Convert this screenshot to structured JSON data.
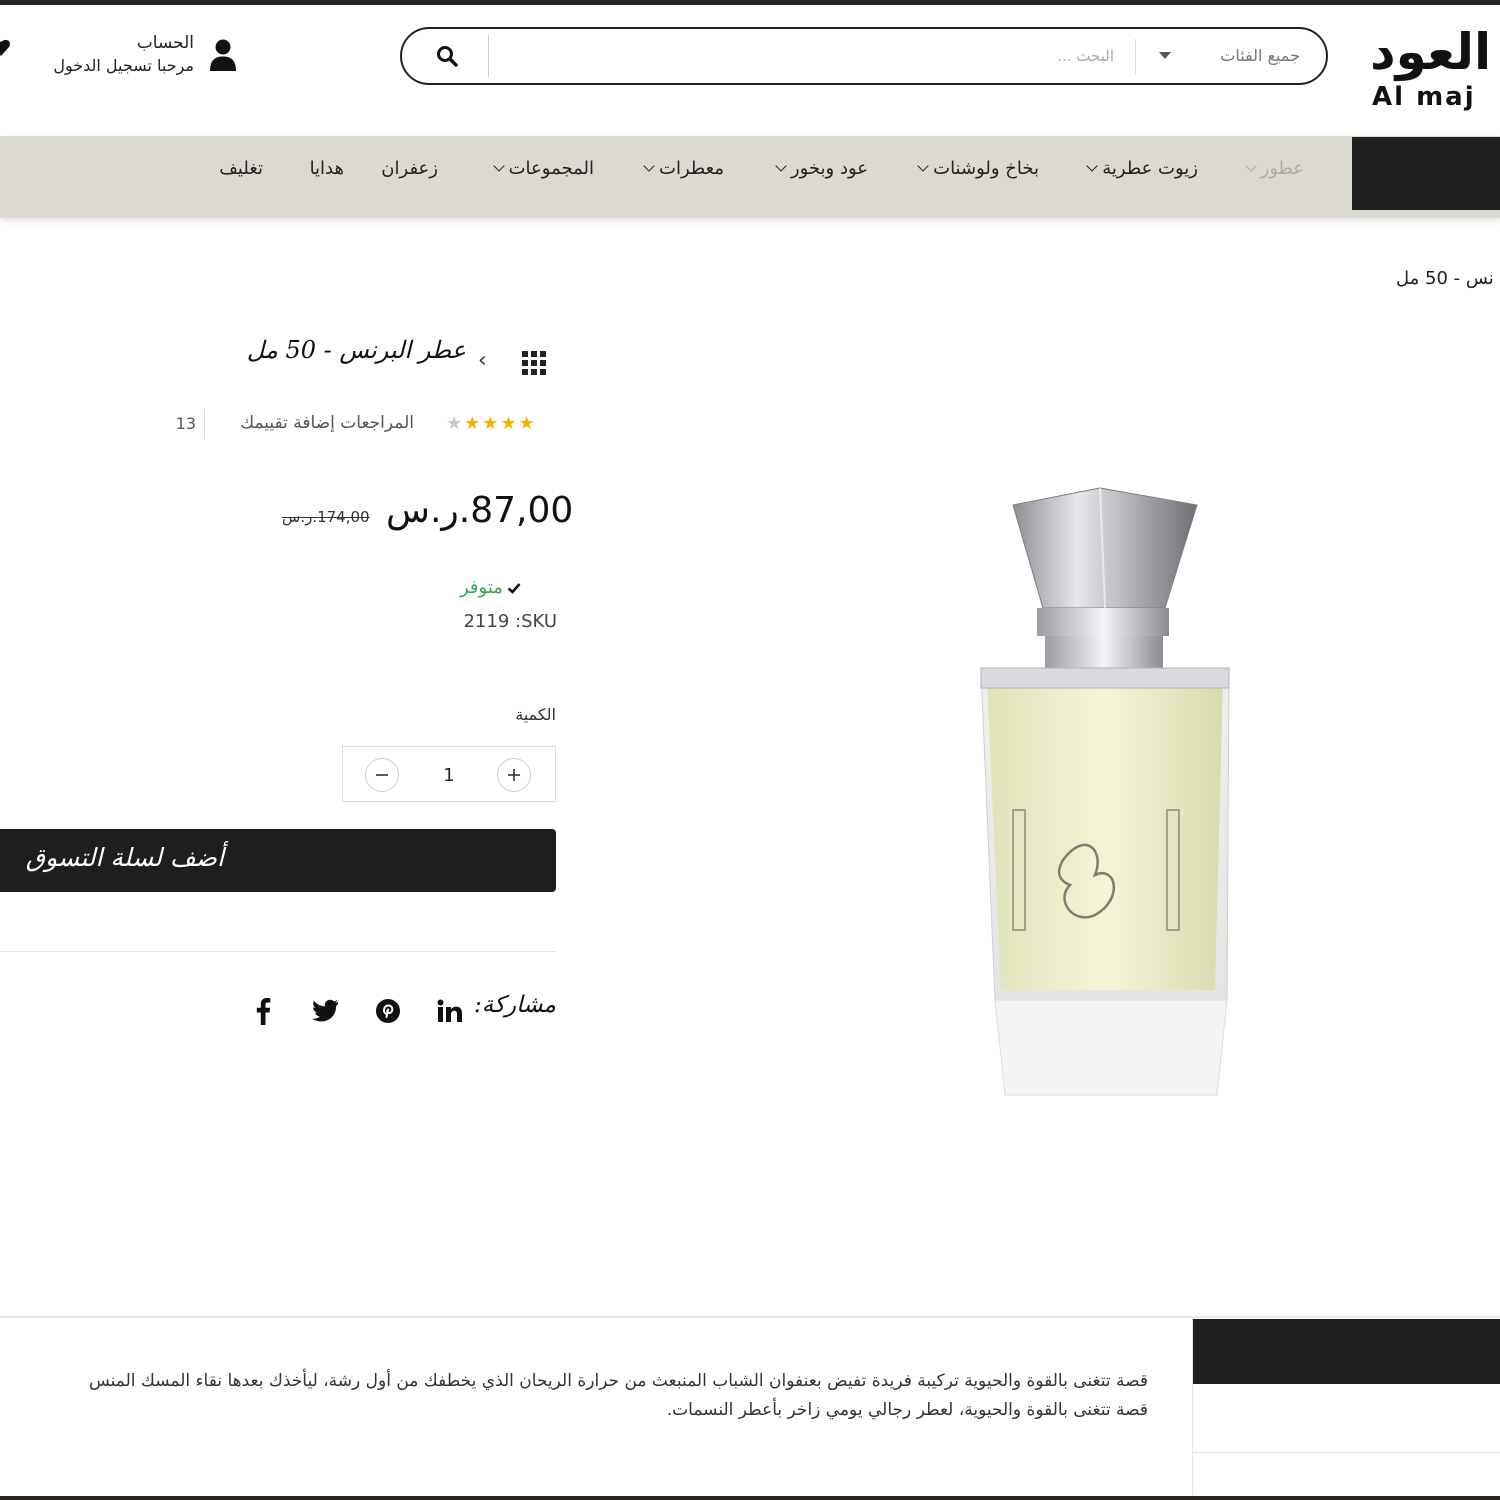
{
  "header": {
    "logo_ar": "العود",
    "logo_en": "Al maj",
    "search": {
      "category": "جميع الفئات",
      "placeholder": "البحث ..."
    },
    "account": {
      "title": "الحساب",
      "subtitle": "مرحبا تسجيل الدخول"
    }
  },
  "nav": {
    "items": [
      {
        "label": "عطور",
        "has_dropdown": true,
        "active": true
      },
      {
        "label": "زيوت عطرية",
        "has_dropdown": true
      },
      {
        "label": "بخاخ ولوشنات",
        "has_dropdown": true
      },
      {
        "label": "عود وبخور",
        "has_dropdown": true
      },
      {
        "label": "معطرات",
        "has_dropdown": true
      },
      {
        "label": "المجموعات",
        "has_dropdown": true
      },
      {
        "label": "زعفران",
        "has_dropdown": false
      },
      {
        "label": "هدايا",
        "has_dropdown": false
      },
      {
        "label": "تغليف",
        "has_dropdown": false
      }
    ]
  },
  "breadcrumb": "نس - 50 مل",
  "product": {
    "title": "عطر البرنس - 50 مل",
    "rating": 4,
    "rating_max": 5,
    "reviews_label": "المراجعات إضافة تقييمك",
    "reviews_count": "13",
    "price": "87,00.ر.س",
    "price_old": "174,00.ر.س",
    "stock": "متوفر",
    "sku": "2119 :SKU",
    "qty_label": "الكمية",
    "qty_value": "1",
    "add_to_cart": "أضف لسلة التسوق",
    "share_label": "مشاركة:"
  },
  "description": {
    "line1": "قصة تتغنى بالقوة والحيوية تركيبة فريدة تفيض بعنفوان الشباب المنبعث من حرارة الريحان الذي يخطفك من أول رشة، ليأخذك بعدها نقاء المسك المنس",
    "line2": "قصة تتغنى بالقوة والحيوية، لعطر رجالي يومي زاخر بأعطر النسمات."
  },
  "colors": {
    "dark": "#1e1e1e",
    "nav_bg": "#dcd9d1",
    "nav_active": "#b2aca0",
    "in_stock": "#3aa652",
    "star": "#f2b300"
  }
}
